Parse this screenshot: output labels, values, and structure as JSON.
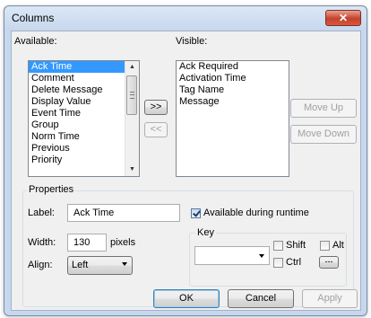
{
  "window": {
    "title": "Columns",
    "close_glyph": "✕"
  },
  "available": {
    "label": "Available:",
    "items": [
      "Ack Time",
      "Comment",
      "Delete Message",
      "Display Value",
      "Event Time",
      "Group",
      "Norm Time",
      "Previous",
      "Priority"
    ],
    "selected": "Ack Time"
  },
  "visible": {
    "label": "Visible:",
    "items": [
      "Ack Required",
      "Activation Time",
      "Tag Name",
      "Message"
    ]
  },
  "buttons": {
    "add": ">>",
    "remove": "<<",
    "move_up": "Move Up",
    "move_down": "Move Down",
    "ok": "OK",
    "cancel": "Cancel",
    "apply": "Apply"
  },
  "properties": {
    "title": "Properties",
    "label_caption": "Label:",
    "label_value": "Ack Time",
    "available_runtime": "Available during runtime",
    "available_runtime_checked": true,
    "width_caption": "Width:",
    "width_value": "130",
    "width_unit": "pixels",
    "align_caption": "Align:",
    "align_value": "Left",
    "key": {
      "title": "Key",
      "value": "",
      "shift": "Shift",
      "alt": "Alt",
      "ctrl": "Ctrl",
      "browse": "---"
    }
  },
  "scroll": {
    "up_glyph": "▲",
    "down_glyph": "▼"
  }
}
